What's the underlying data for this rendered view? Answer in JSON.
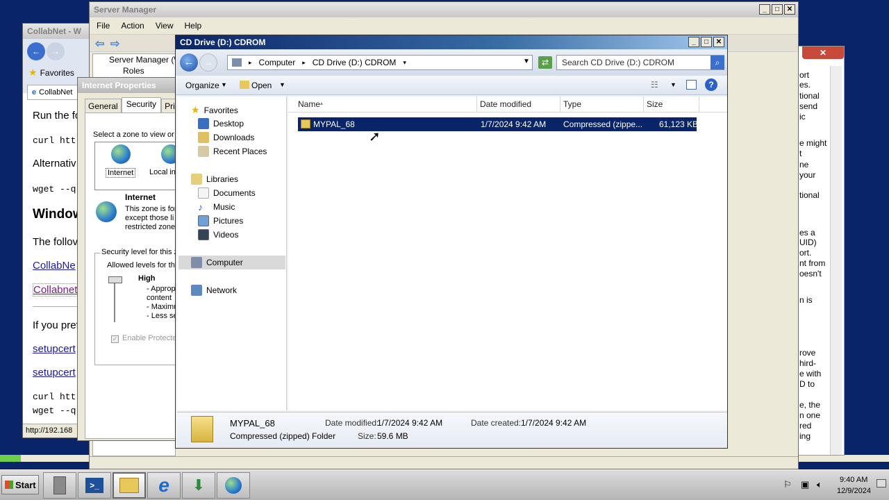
{
  "collabnet": {
    "title": "CollabNet - W",
    "tab": "CollabNet",
    "favorites": "Favorites",
    "lines": [
      "Run the fo",
      "curl htt",
      "Alternativ",
      "wget --q",
      "Window",
      "The follov",
      "CollabNe",
      "Collabnet",
      "If you pref",
      "setupcert",
      "setupcert",
      "curl htt",
      "wget --q"
    ],
    "status": "http://192.168"
  },
  "server_manager": {
    "title": "Server Manager",
    "menu": [
      "File",
      "Action",
      "View",
      "Help"
    ],
    "tree": [
      "Server Manager (W",
      "Roles"
    ]
  },
  "internet_props": {
    "title": "Internet Properties",
    "tabs": [
      "General",
      "Security",
      "Priva"
    ],
    "select_zone": "Select a zone to view or",
    "zones": [
      "Internet",
      "Local in"
    ],
    "zone_title": "Internet",
    "zone_desc": [
      "This zone is for",
      "except those li",
      "restricted zone"
    ],
    "security_level": "Security level for this z",
    "allowed": "Allowed levels for th",
    "level": "High",
    "level_items": [
      "- Approp",
      "content",
      "- Maximu",
      "- Less se"
    ],
    "enable_protected": "Enable Protecte"
  },
  "right_text": [
    "ort",
    "es.",
    "tional",
    "send",
    "ic",
    "e might",
    "t",
    "ne",
    "your",
    "tional",
    "es a",
    "UID)",
    "ort.",
    "nt from",
    "oesn't",
    "n is",
    "rove",
    "hird-",
    "e with",
    "D to",
    "e, the",
    "n one",
    "red",
    "ing"
  ],
  "explorer": {
    "title": "CD Drive (D:) CDROM",
    "breadcrumb": [
      "Computer",
      "CD Drive (D:) CDROM"
    ],
    "search_placeholder": "Search CD Drive (D:) CDROM",
    "toolbar": {
      "organize": "Organize",
      "open": "Open"
    },
    "nav": {
      "favorites": "Favorites",
      "fav_items": [
        "Desktop",
        "Downloads",
        "Recent Places"
      ],
      "libraries": "Libraries",
      "lib_items": [
        "Documents",
        "Music",
        "Pictures",
        "Videos"
      ],
      "computer": "Computer",
      "network": "Network"
    },
    "columns": [
      "Name",
      "Date modified",
      "Type",
      "Size"
    ],
    "files": [
      {
        "name": "MYPAL_68",
        "date": "1/7/2024 9:42 AM",
        "type": "Compressed (zippe...",
        "size": "61,123 KB"
      }
    ],
    "details": {
      "name": "MYPAL_68",
      "type": "Compressed (zipped) Folder",
      "modified_label": "Date modified:",
      "modified": "1/7/2024 9:42 AM",
      "created_label": "Date created:",
      "created": "1/7/2024 9:42 AM",
      "size_label": "Size:",
      "size": "59.6 MB"
    }
  },
  "taskbar": {
    "start": "Start",
    "time": "9:40 AM",
    "date": "12/9/2024"
  },
  "colors": {
    "selection": "#0a246a",
    "desktop": "#0a246a",
    "link": "#1a1aa6"
  }
}
